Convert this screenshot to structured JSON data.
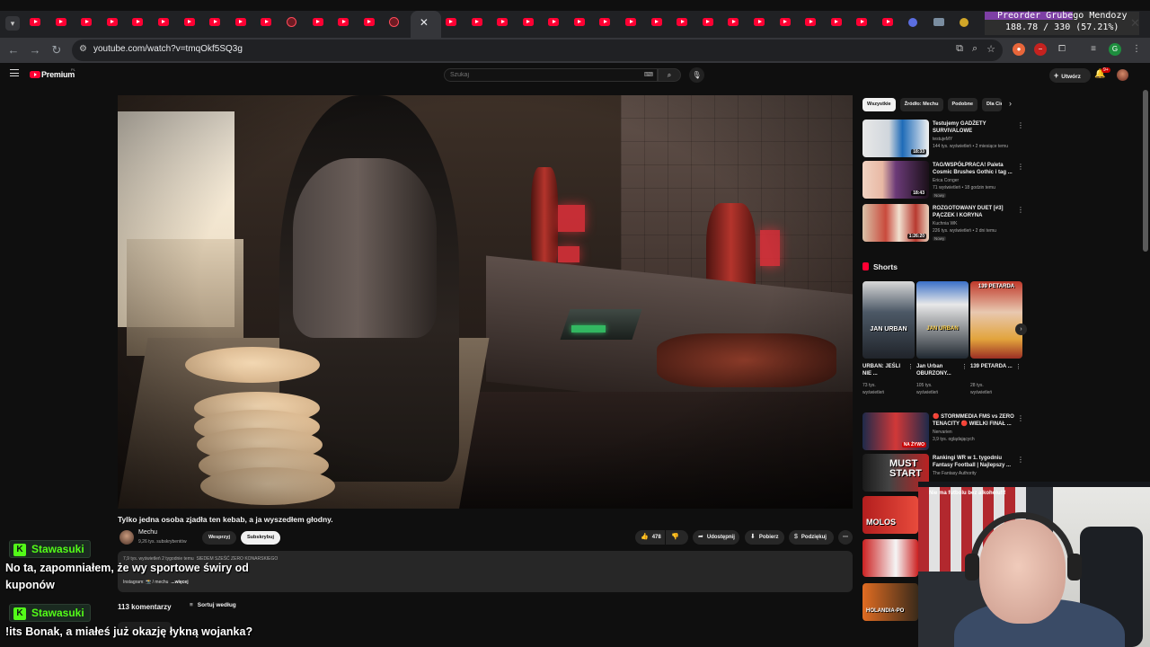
{
  "browser": {
    "url": "youtube.com/watch?v=tmqOkf5SQ3g",
    "close_tab": "✕",
    "close_window": "✕"
  },
  "stream_overlay": {
    "title": "Preorder Grubego Mendozy",
    "progress_text": "188.78 / 330 (57.21%)",
    "progress_fraction": 0.5721,
    "accent_color": "#7d3fa4"
  },
  "yt": {
    "brand": "Premium",
    "region": "PL",
    "search_placeholder": "Szukaj",
    "create_label": "Utwórz",
    "notif_count": "9+",
    "accent_color": "#ff0033"
  },
  "video": {
    "title": "Tylko jedna osoba zjadła ten kebab, a ja wyszedłem głodny.",
    "channel": "Mechu",
    "subscribers": "9,26 tys. subskrybentów",
    "support_label": "Wesprzyj",
    "subscribe_label": "Subskrybuj",
    "likes": "478",
    "share_label": "Udostępnij",
    "download_label": "Pobierz",
    "thanks_label": "Podziękuj",
    "desc_meta": "7,9 tys. wyświetleń  2 tygodnie temu",
    "desc_highlight": "SIEDEM SZEŚĆ ZERO KONARSKIEGO",
    "desc_line": "Instagram: 📸 / mechu",
    "desc_more": "...więcej",
    "comments_count": "113 komentarzy",
    "sort_label": "Sortuj według"
  },
  "sidebar": {
    "chips": [
      "Wszystkie",
      "Źródło: Mechu",
      "Podobne",
      "Dla Ciebie"
    ],
    "recs": [
      {
        "title": "Testujemy GADŻETY SURVIVALOWE",
        "channel": "testujeMY",
        "meta": "144 tys. wyświetleń • 2 miesiące temu",
        "duration": "18:33",
        "badge": ""
      },
      {
        "title": "TAG/WSPÓŁPRACA! Paleta Cosmic Brushes Gothic i tag ...",
        "channel": "Erica Conger",
        "meta": "71 wyświetleń • 18 godzin temu",
        "duration": "18:43",
        "badge": "Nowy"
      },
      {
        "title": "ROZGOTOWANY DUET [#3] PĄCZEK I KORYNA",
        "channel": "Kuchnia WK",
        "meta": "226 tys. wyświetleń • 2 dni temu",
        "duration": "1:26:20",
        "badge": "Nowy"
      }
    ],
    "shorts_label": "Shorts",
    "shorts": [
      {
        "title": "URBAN: JEŚLI NIE ...",
        "views": "73 tys. wyświetleń",
        "thumb_text": "JAN URBAN"
      },
      {
        "title": "Jan Urban OBURZONY...",
        "views": "105 tys. wyświetleń",
        "thumb_text": "JAN URBAN"
      },
      {
        "title": "139 PETARDA ...",
        "views": "28 tys. wyświetleń",
        "thumb_text": "139 PETARDA"
      }
    ],
    "recs2": [
      {
        "title": "🔴 STORMMEDIA FMS vs ZERO TENACITY 🔴 WIELKI FINAŁ ...",
        "channel": "Nervarien",
        "meta": "3,9 tys. oglądających",
        "thumb_text": "NA ŻYWO"
      },
      {
        "title": "Rankingi WR w 1. tygodniu Fantasy Football | Najlepszy ...",
        "channel": "The Fantasy Authority",
        "meta": "",
        "thumb_text": "MUST START"
      }
    ],
    "small_thumbs": [
      "MOLOS",
      "",
      "HOLANDIA-PO"
    ]
  },
  "chat": [
    {
      "user": "Stawasuki",
      "message": "No ta, zapomniałem, że wy sportowe świry od kuponów"
    },
    {
      "user": "Stawasuki",
      "message": "!its Bonak, a miałeś już okazję łykną wojanka?"
    }
  ],
  "webcam": {
    "banner_text": "Nie ma futbolu bez alkoholu!!!"
  }
}
